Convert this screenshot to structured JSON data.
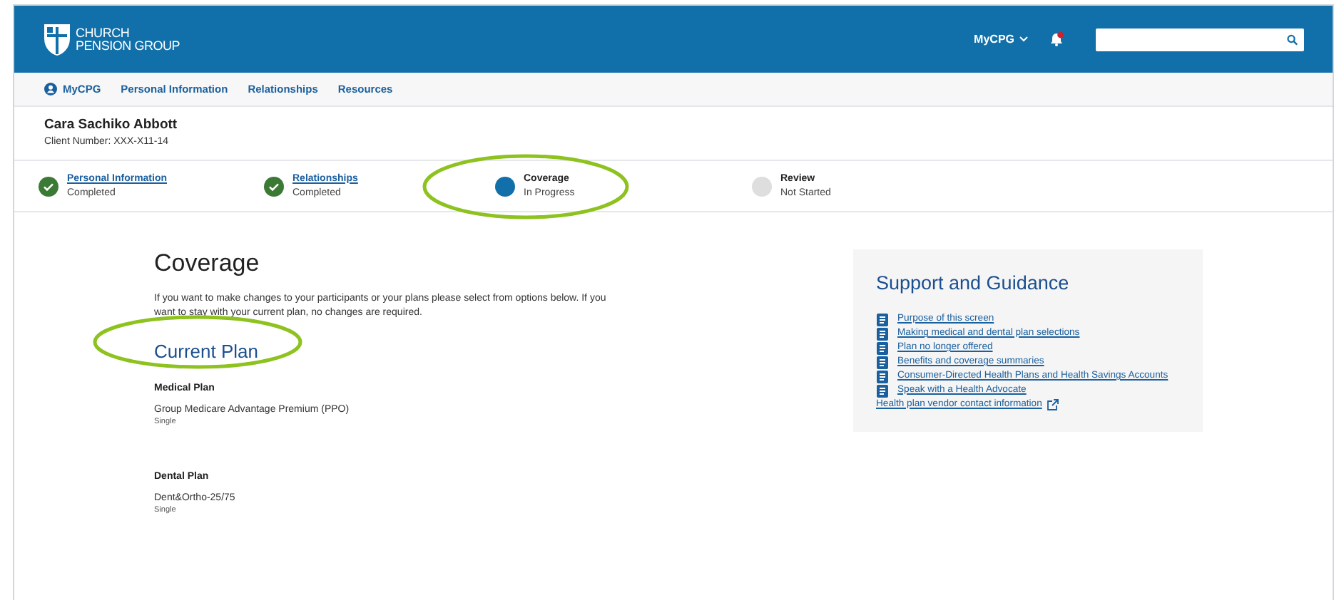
{
  "header": {
    "logo_line_1": "CHURCH",
    "logo_line_2": "PENSION GROUP",
    "account_menu": "MyCPG",
    "notification_unread": true
  },
  "nav": {
    "items": [
      {
        "label": "MyCPG",
        "kind": "account"
      },
      {
        "label": "Personal Information",
        "kind": "link"
      },
      {
        "label": "Relationships",
        "kind": "link"
      },
      {
        "label": "Resources",
        "kind": "link"
      }
    ]
  },
  "client": {
    "name": "Cara Sachiko Abbott",
    "number": "Client Number: XXX-X11-14"
  },
  "steps": [
    {
      "label": "Personal Information",
      "status": "Completed",
      "kind": "completed"
    },
    {
      "label": "Relationships",
      "status": "Completed",
      "kind": "completed"
    },
    {
      "label": "Coverage",
      "status": "In Progress",
      "kind": "current"
    },
    {
      "label": "Review",
      "status": "Not Started",
      "kind": "pending"
    }
  ],
  "main": {
    "title": "Coverage",
    "intro": "If you want to make changes to your participants or your plans please select from options below. If you want to stay with your current plan, no changes are required.",
    "section_title": "Current Plan",
    "plans": [
      {
        "heading": "Medical Plan",
        "name": "Group Medicare Advantage Premium (PPO)",
        "tier": "Single"
      },
      {
        "heading": "Dental Plan",
        "name": "Dent&Ortho-25/75",
        "tier": "Single"
      }
    ]
  },
  "support": {
    "title": "Support and Guidance",
    "links": [
      {
        "label": "Purpose of this screen",
        "kind": "document"
      },
      {
        "label": "Making medical and dental plan selections",
        "kind": "document"
      },
      {
        "label": "Plan no longer offered",
        "kind": "document"
      },
      {
        "label": "Benefits and coverage summaries",
        "kind": "document"
      },
      {
        "label": "Consumer-Directed Health Plans and Health Savings Accounts",
        "kind": "document"
      },
      {
        "label": "Speak with a Health Advocate",
        "kind": "document"
      },
      {
        "label": "Health plan vendor contact information",
        "kind": "external"
      }
    ]
  }
}
